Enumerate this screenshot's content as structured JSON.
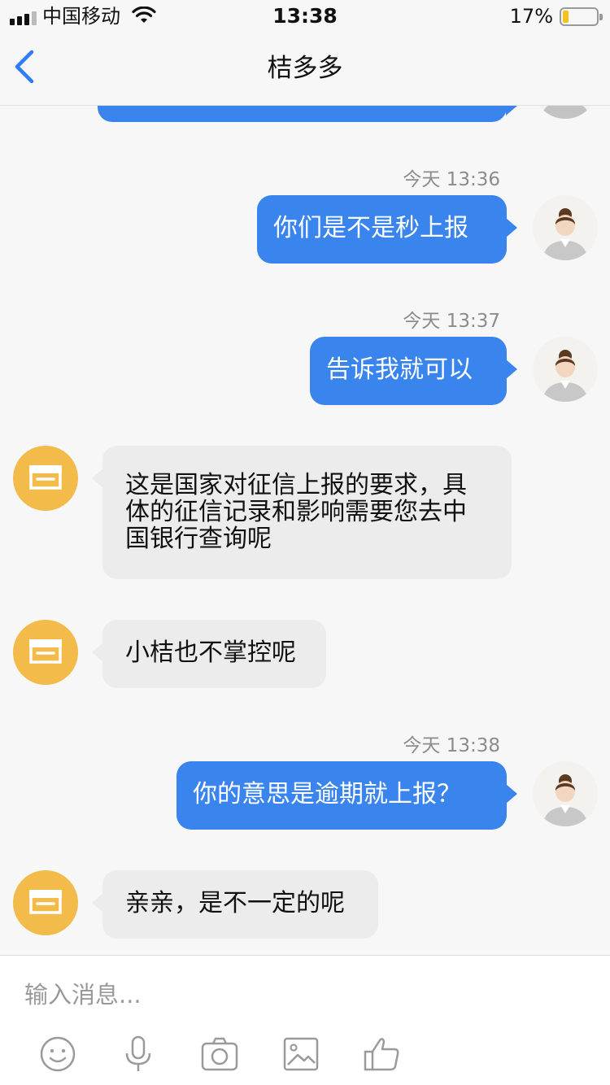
{
  "status_bar": {
    "carrier": "中国移动",
    "time": "13:38",
    "battery_percent": "17%",
    "battery_level": 0.17,
    "icons": [
      "signal-icon",
      "wifi-icon",
      "battery-icon"
    ]
  },
  "nav": {
    "title": "桔多多",
    "back_icon": "chevron-left-icon"
  },
  "messages": [
    {
      "type": "timestamp",
      "text": "今天 13:36"
    },
    {
      "type": "outgoing",
      "text": "你们是不是秒上报"
    },
    {
      "type": "timestamp",
      "text": "今天 13:37"
    },
    {
      "type": "outgoing",
      "text": "告诉我就可以"
    },
    {
      "type": "incoming",
      "text": "这是国家对征信上报的要求，具体的征信记录和影响需要您去中国银行查询呢",
      "lines": [
        "这是国家对征信上报的要求，具",
        "体的征信记录和影响需要您去中",
        "国银行查询呢"
      ]
    },
    {
      "type": "incoming",
      "text": "小桔也不掌控呢"
    },
    {
      "type": "timestamp",
      "text": "今天 13:38"
    },
    {
      "type": "outgoing",
      "text": "你的意思是逾期就上报？"
    },
    {
      "type": "incoming",
      "text": "亲亲，是不一定的呢"
    }
  ],
  "input": {
    "placeholder": "输入消息..."
  },
  "toolbar": {
    "icons": [
      "emoji-icon",
      "microphone-icon",
      "camera-icon",
      "image-icon",
      "thumbs-up-icon"
    ]
  },
  "colors": {
    "outgoing_bubble": "#3a84ee",
    "incoming_bubble": "#ececec",
    "shop_avatar": "#f2bb4a",
    "back_arrow": "#2f7cf6",
    "battery_fill": "#f4c21c"
  }
}
